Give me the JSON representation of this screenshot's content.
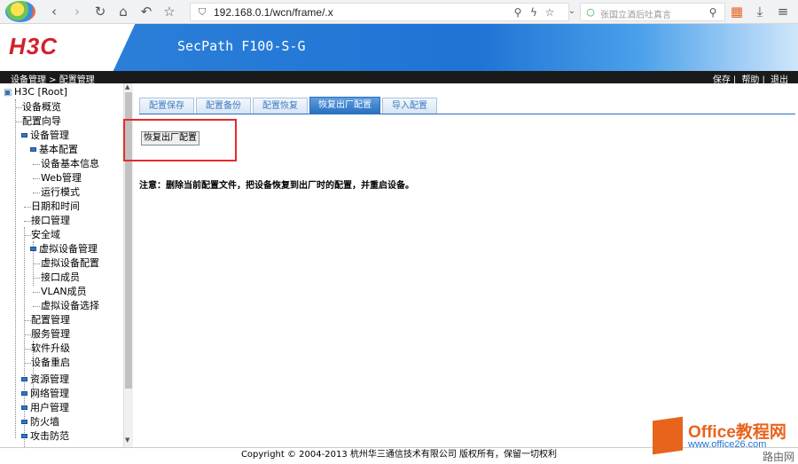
{
  "browser": {
    "url": "192.168.0.1/wcn/frame/.x",
    "search_placeholder": "张国立酒后吐真言"
  },
  "header": {
    "brand": "H3C",
    "model": "SecPath F100-S-G"
  },
  "navstrip": {
    "breadcrumb": "设备管理 > 配置管理",
    "save": "保存",
    "help": "帮助",
    "logout": "退出"
  },
  "sidebar": {
    "root": "H3C [Root]",
    "items": [
      {
        "label": "设备概览"
      },
      {
        "label": "配置向导"
      },
      {
        "label": "设备管理"
      },
      {
        "label": "基本配置"
      },
      {
        "label": "设备基本信息"
      },
      {
        "label": "Web管理"
      },
      {
        "label": "运行模式"
      },
      {
        "label": "日期和时间"
      },
      {
        "label": "接口管理"
      },
      {
        "label": "安全域"
      },
      {
        "label": "虚拟设备管理"
      },
      {
        "label": "虚拟设备配置"
      },
      {
        "label": "接口成员"
      },
      {
        "label": "VLAN成员"
      },
      {
        "label": "虚拟设备选择"
      },
      {
        "label": "配置管理"
      },
      {
        "label": "服务管理"
      },
      {
        "label": "软件升级"
      },
      {
        "label": "设备重启"
      },
      {
        "label": "资源管理"
      },
      {
        "label": "网络管理"
      },
      {
        "label": "用户管理"
      },
      {
        "label": "防火墙"
      },
      {
        "label": "攻击防范"
      }
    ]
  },
  "main": {
    "tabs": [
      {
        "label": "配置保存"
      },
      {
        "label": "配置备份"
      },
      {
        "label": "配置恢复"
      },
      {
        "label": "恢复出厂配置",
        "active": true
      },
      {
        "label": "导入配置"
      }
    ],
    "restore_button": "恢复出厂配置",
    "note": "注意：删除当前配置文件，把设备恢复到出厂时的配置，并重启设备。"
  },
  "footer": {
    "copyright": "Copyright © 2004-2013 杭州华三通信技术有限公司 版权所有，保留一切权利"
  },
  "watermark": {
    "title": "Office教程网",
    "url": "www.office26.com",
    "sub": "路由网"
  },
  "colors": {
    "brand_red": "#d3202a",
    "accent_blue": "#2a6fbf",
    "highlight_red": "#e52b2b"
  }
}
